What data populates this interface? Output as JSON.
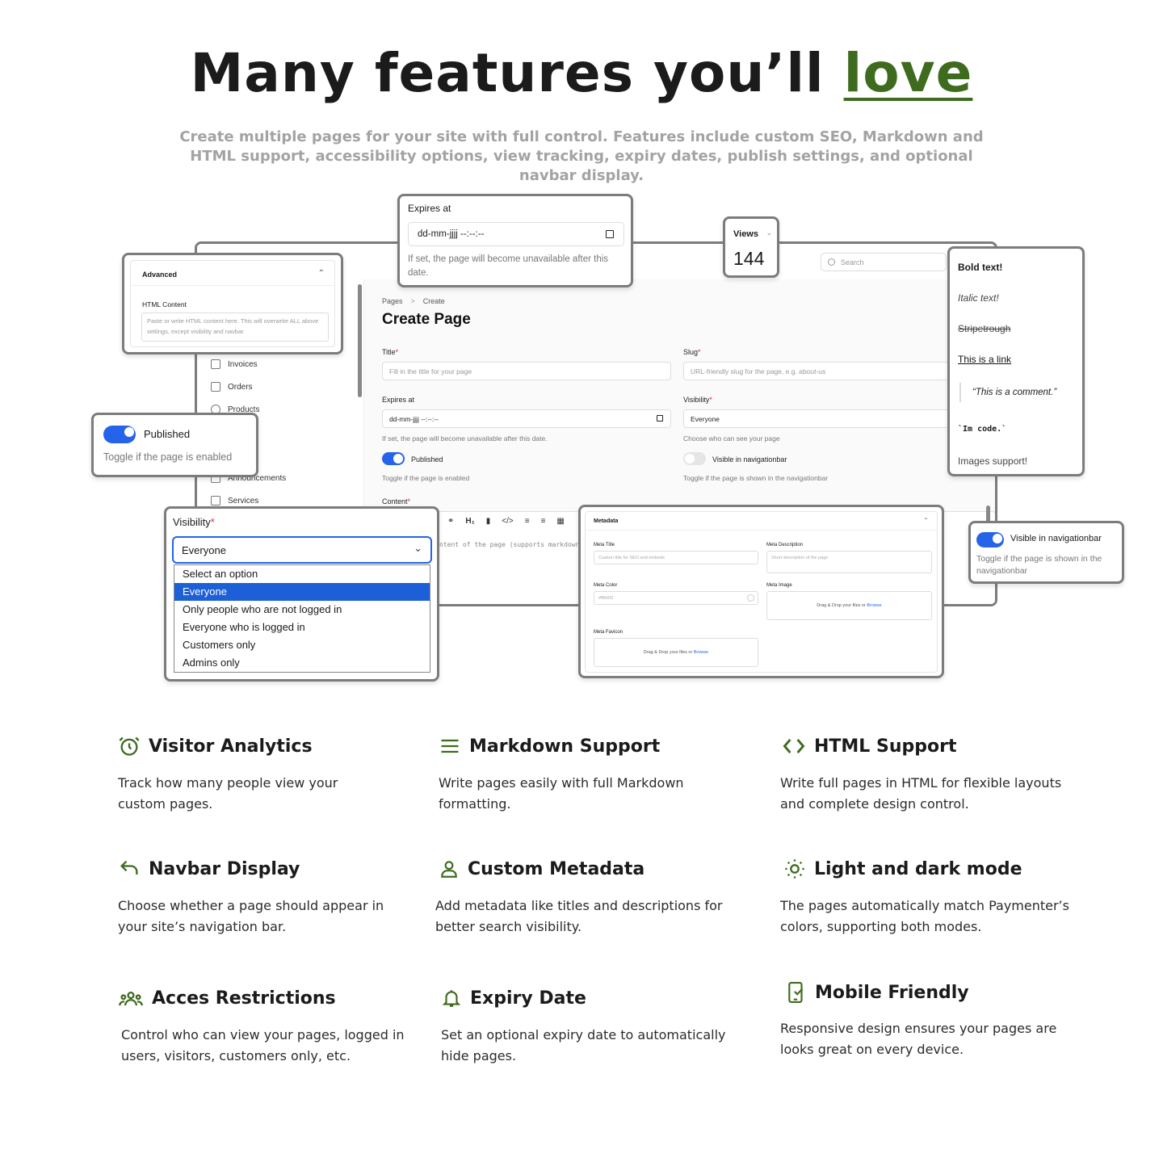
{
  "hero": {
    "title_main": "Many features you’ll ",
    "title_accent": "love",
    "subtitle": "Create multiple pages for your site with full control. Features include custom SEO, Markdown and HTML support, accessibility options, view tracking, expiry dates, publish settings, and optional navbar display."
  },
  "colors": {
    "accent": "#3f6b1f",
    "toggle": "#2563eb"
  },
  "window": {
    "search_placeholder": "Search",
    "sidebar": [
      {
        "label": "Invoices",
        "icon": "invoice-icon"
      },
      {
        "label": "Orders",
        "icon": "orders-icon"
      },
      {
        "label": "Products",
        "icon": "products-icon"
      },
      {
        "label": "Announcements",
        "icon": "announcement-icon"
      },
      {
        "label": "Services",
        "icon": "services-icon"
      }
    ],
    "breadcrumb": [
      "Pages",
      "Create"
    ],
    "page_title": "Create Page",
    "title_label": "Title",
    "title_placeholder": "Fill in the title for your page",
    "slug_label": "Slug",
    "slug_placeholder": "URL-friendly slug for the page, e.g. about-us",
    "expires_label": "Expires at",
    "expires_value": "dd-mm-jjjj --:--:--",
    "expires_hint": "If set, the page will become unavailable after this date.",
    "visibility_label": "Visibility",
    "visibility_value": "Everyone",
    "visibility_hint": "Choose who can see your page",
    "published_label": "Published",
    "published_hint": "Toggle if the page is enabled",
    "navbar_label": "Visible in navigationbar",
    "navbar_hint": "Toggle if the page is shown in the navigationbar",
    "content_label": "Content",
    "content_placeholder": "ntent of the page (supports markdown"
  },
  "advanced_card": {
    "title": "Advanced",
    "html_label": "HTML Content",
    "html_placeholder": "Paste or write HTML content here. This will overwrite ALL above settings, except visibility and navbar"
  },
  "expires_card": {
    "label": "Expires at",
    "value": "dd-mm-jjjj --:--:--",
    "hint": "If set, the page will become unavailable after this date."
  },
  "views_card": {
    "label": "Views",
    "value": "144"
  },
  "markdown_card": {
    "bold": "Bold text!",
    "italic": "Italic text!",
    "strike": "Stripetrough",
    "link": "This is a link",
    "quote": "“This is a comment.”",
    "code": "`Im code.`",
    "images": "Images support!"
  },
  "published_card": {
    "label": "Published",
    "hint": "Toggle if the page is enabled"
  },
  "visibility_card": {
    "label": "Visibility",
    "selected": "Everyone",
    "options": [
      "Select an option",
      "Everyone",
      "Only people who are not logged in",
      "Everyone who is logged in",
      "Customers only",
      "Admins only"
    ]
  },
  "metadata_card": {
    "title": "Metadata",
    "meta_title_label": "Meta Title",
    "meta_title_placeholder": "Custom title for SEO and embeds",
    "meta_desc_label": "Meta Description",
    "meta_desc_placeholder": "Short description of the page",
    "meta_color_label": "Meta Color",
    "meta_color_value": "#ff6600",
    "meta_image_label": "Meta Image",
    "drop_text": "Drag & Drop your files or ",
    "browse": "Browse",
    "favicon_label": "Meta Favicon"
  },
  "navbar_card": {
    "label": "Visible in navigationbar",
    "hint": "Toggle if the page is shown in the navigationbar"
  },
  "features": [
    {
      "title": "Visitor Analytics",
      "icon": "alarm-clock-icon",
      "desc": "Track how many people view your custom pages."
    },
    {
      "title": "Markdown Support",
      "icon": "menu-lines-icon",
      "desc": "Write pages easily with full Markdown formatting."
    },
    {
      "title": "HTML Support",
      "icon": "code-brackets-icon",
      "desc": "Write full pages in HTML for flexible layouts and complete design control."
    },
    {
      "title": "Navbar Display",
      "icon": "arrow-back-icon",
      "desc": "Choose whether a page should appear in your site’s navigation bar."
    },
    {
      "title": "Custom Metadata",
      "icon": "user-icon",
      "desc": "Add metadata like titles and descriptions for better search visibility."
    },
    {
      "title": "Light and dark mode",
      "icon": "sun-icon",
      "desc": "The pages automatically match Paymenter’s colors, supporting both modes."
    },
    {
      "title": "Acces Restrictions",
      "icon": "users-group-icon",
      "desc": "Control who can view your pages, logged in users, visitors, customers only, etc."
    },
    {
      "title": "Expiry Date",
      "icon": "bell-icon",
      "desc": "Set an optional expiry date to automatically hide pages."
    },
    {
      "title": "Mobile Friendly",
      "icon": "mobile-check-icon",
      "desc": "Responsive design ensures your pages are looks great on every device."
    }
  ]
}
